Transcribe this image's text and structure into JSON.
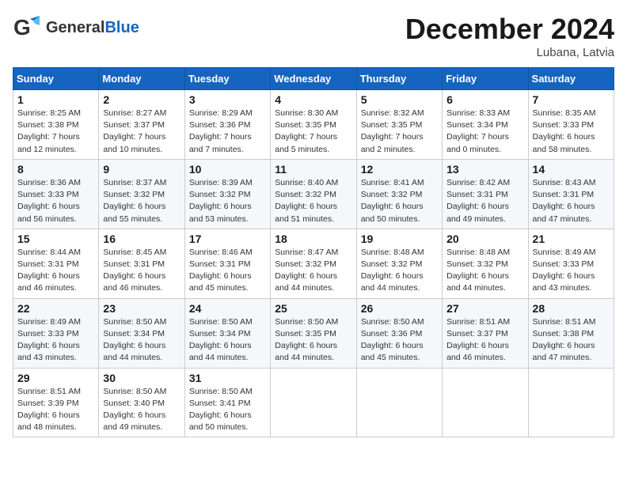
{
  "logo": {
    "general": "General",
    "blue": "Blue"
  },
  "title": "December 2024",
  "location": "Lubana, Latvia",
  "days_of_week": [
    "Sunday",
    "Monday",
    "Tuesday",
    "Wednesday",
    "Thursday",
    "Friday",
    "Saturday"
  ],
  "weeks": [
    [
      {
        "day": "1",
        "info": "Sunrise: 8:25 AM\nSunset: 3:38 PM\nDaylight: 7 hours\nand 12 minutes."
      },
      {
        "day": "2",
        "info": "Sunrise: 8:27 AM\nSunset: 3:37 PM\nDaylight: 7 hours\nand 10 minutes."
      },
      {
        "day": "3",
        "info": "Sunrise: 8:29 AM\nSunset: 3:36 PM\nDaylight: 7 hours\nand 7 minutes."
      },
      {
        "day": "4",
        "info": "Sunrise: 8:30 AM\nSunset: 3:35 PM\nDaylight: 7 hours\nand 5 minutes."
      },
      {
        "day": "5",
        "info": "Sunrise: 8:32 AM\nSunset: 3:35 PM\nDaylight: 7 hours\nand 2 minutes."
      },
      {
        "day": "6",
        "info": "Sunrise: 8:33 AM\nSunset: 3:34 PM\nDaylight: 7 hours\nand 0 minutes."
      },
      {
        "day": "7",
        "info": "Sunrise: 8:35 AM\nSunset: 3:33 PM\nDaylight: 6 hours\nand 58 minutes."
      }
    ],
    [
      {
        "day": "8",
        "info": "Sunrise: 8:36 AM\nSunset: 3:33 PM\nDaylight: 6 hours\nand 56 minutes."
      },
      {
        "day": "9",
        "info": "Sunrise: 8:37 AM\nSunset: 3:32 PM\nDaylight: 6 hours\nand 55 minutes."
      },
      {
        "day": "10",
        "info": "Sunrise: 8:39 AM\nSunset: 3:32 PM\nDaylight: 6 hours\nand 53 minutes."
      },
      {
        "day": "11",
        "info": "Sunrise: 8:40 AM\nSunset: 3:32 PM\nDaylight: 6 hours\nand 51 minutes."
      },
      {
        "day": "12",
        "info": "Sunrise: 8:41 AM\nSunset: 3:32 PM\nDaylight: 6 hours\nand 50 minutes."
      },
      {
        "day": "13",
        "info": "Sunrise: 8:42 AM\nSunset: 3:31 PM\nDaylight: 6 hours\nand 49 minutes."
      },
      {
        "day": "14",
        "info": "Sunrise: 8:43 AM\nSunset: 3:31 PM\nDaylight: 6 hours\nand 47 minutes."
      }
    ],
    [
      {
        "day": "15",
        "info": "Sunrise: 8:44 AM\nSunset: 3:31 PM\nDaylight: 6 hours\nand 46 minutes."
      },
      {
        "day": "16",
        "info": "Sunrise: 8:45 AM\nSunset: 3:31 PM\nDaylight: 6 hours\nand 46 minutes."
      },
      {
        "day": "17",
        "info": "Sunrise: 8:46 AM\nSunset: 3:31 PM\nDaylight: 6 hours\nand 45 minutes."
      },
      {
        "day": "18",
        "info": "Sunrise: 8:47 AM\nSunset: 3:32 PM\nDaylight: 6 hours\nand 44 minutes."
      },
      {
        "day": "19",
        "info": "Sunrise: 8:48 AM\nSunset: 3:32 PM\nDaylight: 6 hours\nand 44 minutes."
      },
      {
        "day": "20",
        "info": "Sunrise: 8:48 AM\nSunset: 3:32 PM\nDaylight: 6 hours\nand 44 minutes."
      },
      {
        "day": "21",
        "info": "Sunrise: 8:49 AM\nSunset: 3:33 PM\nDaylight: 6 hours\nand 43 minutes."
      }
    ],
    [
      {
        "day": "22",
        "info": "Sunrise: 8:49 AM\nSunset: 3:33 PM\nDaylight: 6 hours\nand 43 minutes."
      },
      {
        "day": "23",
        "info": "Sunrise: 8:50 AM\nSunset: 3:34 PM\nDaylight: 6 hours\nand 44 minutes."
      },
      {
        "day": "24",
        "info": "Sunrise: 8:50 AM\nSunset: 3:34 PM\nDaylight: 6 hours\nand 44 minutes."
      },
      {
        "day": "25",
        "info": "Sunrise: 8:50 AM\nSunset: 3:35 PM\nDaylight: 6 hours\nand 44 minutes."
      },
      {
        "day": "26",
        "info": "Sunrise: 8:50 AM\nSunset: 3:36 PM\nDaylight: 6 hours\nand 45 minutes."
      },
      {
        "day": "27",
        "info": "Sunrise: 8:51 AM\nSunset: 3:37 PM\nDaylight: 6 hours\nand 46 minutes."
      },
      {
        "day": "28",
        "info": "Sunrise: 8:51 AM\nSunset: 3:38 PM\nDaylight: 6 hours\nand 47 minutes."
      }
    ],
    [
      {
        "day": "29",
        "info": "Sunrise: 8:51 AM\nSunset: 3:39 PM\nDaylight: 6 hours\nand 48 minutes."
      },
      {
        "day": "30",
        "info": "Sunrise: 8:50 AM\nSunset: 3:40 PM\nDaylight: 6 hours\nand 49 minutes."
      },
      {
        "day": "31",
        "info": "Sunrise: 8:50 AM\nSunset: 3:41 PM\nDaylight: 6 hours\nand 50 minutes."
      },
      {
        "day": "",
        "info": ""
      },
      {
        "day": "",
        "info": ""
      },
      {
        "day": "",
        "info": ""
      },
      {
        "day": "",
        "info": ""
      }
    ]
  ]
}
